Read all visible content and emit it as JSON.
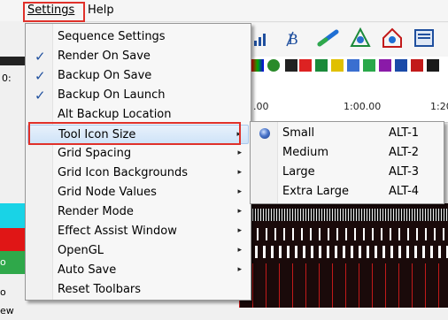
{
  "menubar": {
    "settings_label": "Settings",
    "help_label": "Help"
  },
  "ruler": {
    "ticks": [
      ".00",
      "1:00.00",
      "1:20"
    ]
  },
  "left_strip": {
    "labels": [
      "0:",
      "o",
      "o",
      "ew"
    ]
  },
  "settings_menu": {
    "items": [
      {
        "label": "Sequence Settings"
      },
      {
        "label": "Render On Save",
        "checked": true
      },
      {
        "label": "Backup On Save",
        "checked": true
      },
      {
        "label": "Backup On Launch",
        "checked": true
      },
      {
        "label": "Alt Backup Location"
      },
      {
        "label": "Tool Icon Size",
        "submenu": true,
        "highlighted": true
      },
      {
        "label": "Grid Spacing",
        "submenu": true
      },
      {
        "label": "Grid Icon Backgrounds",
        "submenu": true
      },
      {
        "label": "Grid Node Values",
        "submenu": true
      },
      {
        "label": "Render Mode",
        "submenu": true
      },
      {
        "label": "Effect Assist Window",
        "submenu": true
      },
      {
        "label": "OpenGL",
        "submenu": true
      },
      {
        "label": "Auto Save",
        "submenu": true
      },
      {
        "label": "Reset Toolbars"
      }
    ],
    "check_glyph": "✓",
    "arrow_glyph": "▸"
  },
  "tool_icon_size_submenu": {
    "items": [
      {
        "label": "Small",
        "accel": "ALT-1",
        "selected": true
      },
      {
        "label": "Medium",
        "accel": "ALT-2"
      },
      {
        "label": "Large",
        "accel": "ALT-3"
      },
      {
        "label": "Extra Large",
        "accel": "ALT-4"
      }
    ]
  },
  "colors": {
    "highlight_box": "#e0312a",
    "menu_hover": "#cfe3f8",
    "check": "#1f4f9e"
  }
}
